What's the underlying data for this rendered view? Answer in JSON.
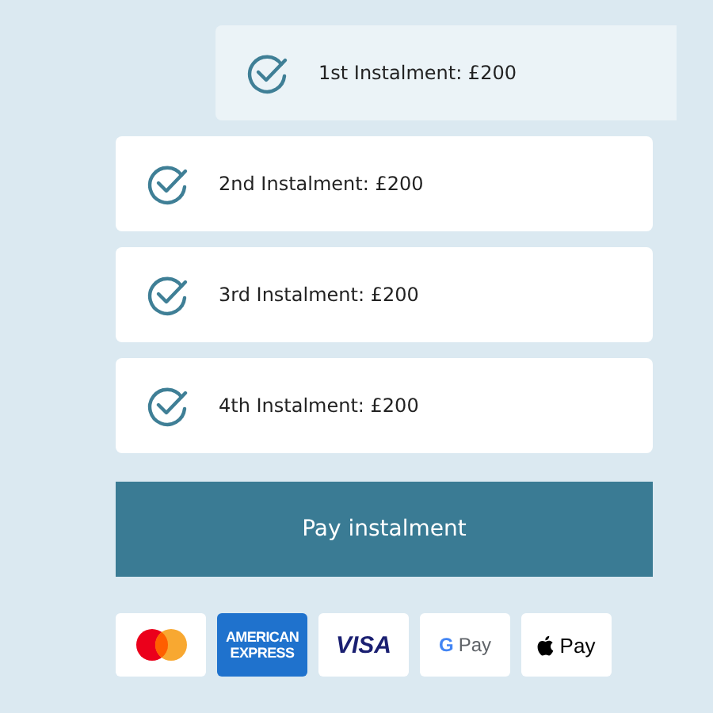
{
  "instalments": [
    {
      "label": "1st Instalment: £200",
      "paid": true
    },
    {
      "label": "2nd Instalment: £200",
      "paid": false
    },
    {
      "label": "3rd Instalment: £200",
      "paid": false
    },
    {
      "label": "4th Instalment: £200",
      "paid": false
    }
  ],
  "pay_button": "Pay instalment",
  "payment_methods": [
    {
      "kind": "mastercard"
    },
    {
      "kind": "amex",
      "lines": [
        "AMERICAN",
        "EXPRESS"
      ]
    },
    {
      "kind": "visa",
      "label": "VISA"
    },
    {
      "kind": "gpay",
      "mark": "G",
      "label": "Pay"
    },
    {
      "kind": "applepay",
      "label": "Pay"
    }
  ]
}
